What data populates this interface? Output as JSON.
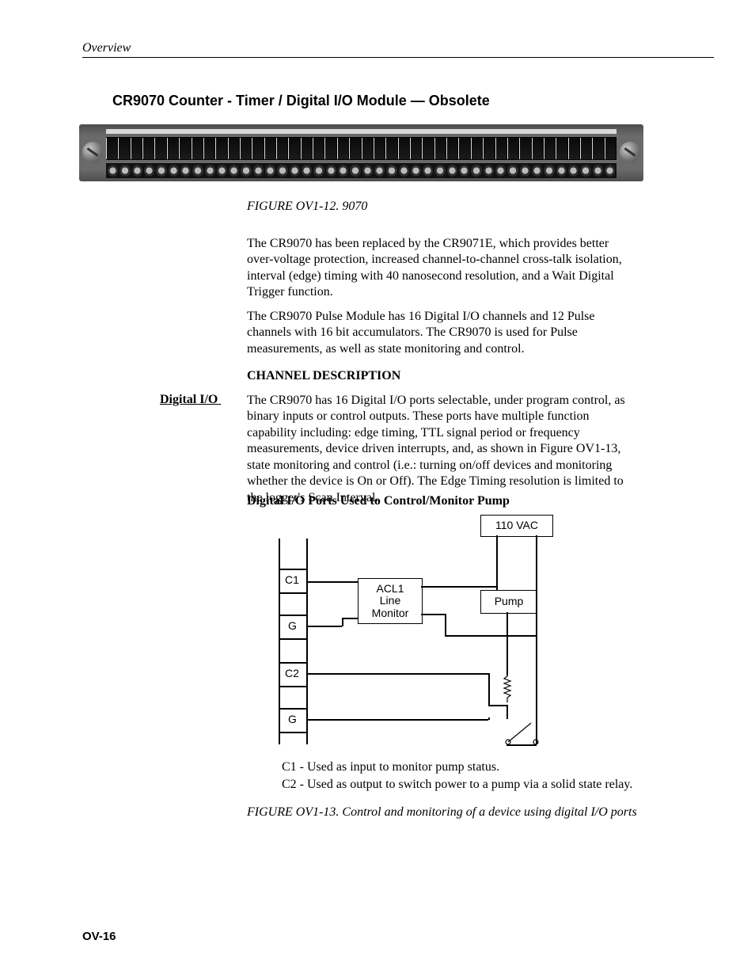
{
  "header": {
    "section": "Overview"
  },
  "title": "CR9070 Counter - Timer / Digital I/O Module — Obsolete",
  "figure12_caption": "FIGURE OV1-12.  9070",
  "para1": "The CR9070 has been replaced by the CR9071E, which provides better over-voltage protection, increased channel-to-channel cross-talk isolation, interval (edge) timing with 40 nanosecond resolution, and a Wait Digital Trigger function.",
  "para2": "The CR9070 Pulse Module has 16 Digital I/O channels and 12 Pulse channels with 16 bit accumulators.  The CR9070 is used for Pulse measurements, as well as state monitoring and control.",
  "channel_desc_heading": "CHANNEL DESCRIPTION",
  "side_label": "Digital I/O",
  "para3": "The CR9070 has 16 Digital I/O ports selectable, under program control, as binary inputs or control outputs.   These ports have multiple function capability including: edge timing, TTL signal period or frequency measurements, device driven interrupts, and, as shown in Figure OV1-13, state monitoring and control (i.e.: turning on/off devices and monitoring whether the device is On or Off). The Edge Timing resolution is limited to the logger's Scan Interval.",
  "subhead": "Digital I/O Ports Used to Control/Monitor Pump",
  "diagram": {
    "c1": "C1",
    "g1": "G",
    "c2": "C2",
    "g2": "G",
    "acl1_line1": "ACL1",
    "acl1_line2": "Line",
    "acl1_line3": "Monitor",
    "vac": "110 VAC",
    "pump": "Pump"
  },
  "caption_list": {
    "c1": "C1 -  Used as input to monitor pump status.",
    "c2": "C2 -  Used as output to switch power to a pump via a solid state relay."
  },
  "figure13_caption": "FIGURE OV1-13.  Control and monitoring of a device using digital I/O ports",
  "page_num": "OV-16"
}
